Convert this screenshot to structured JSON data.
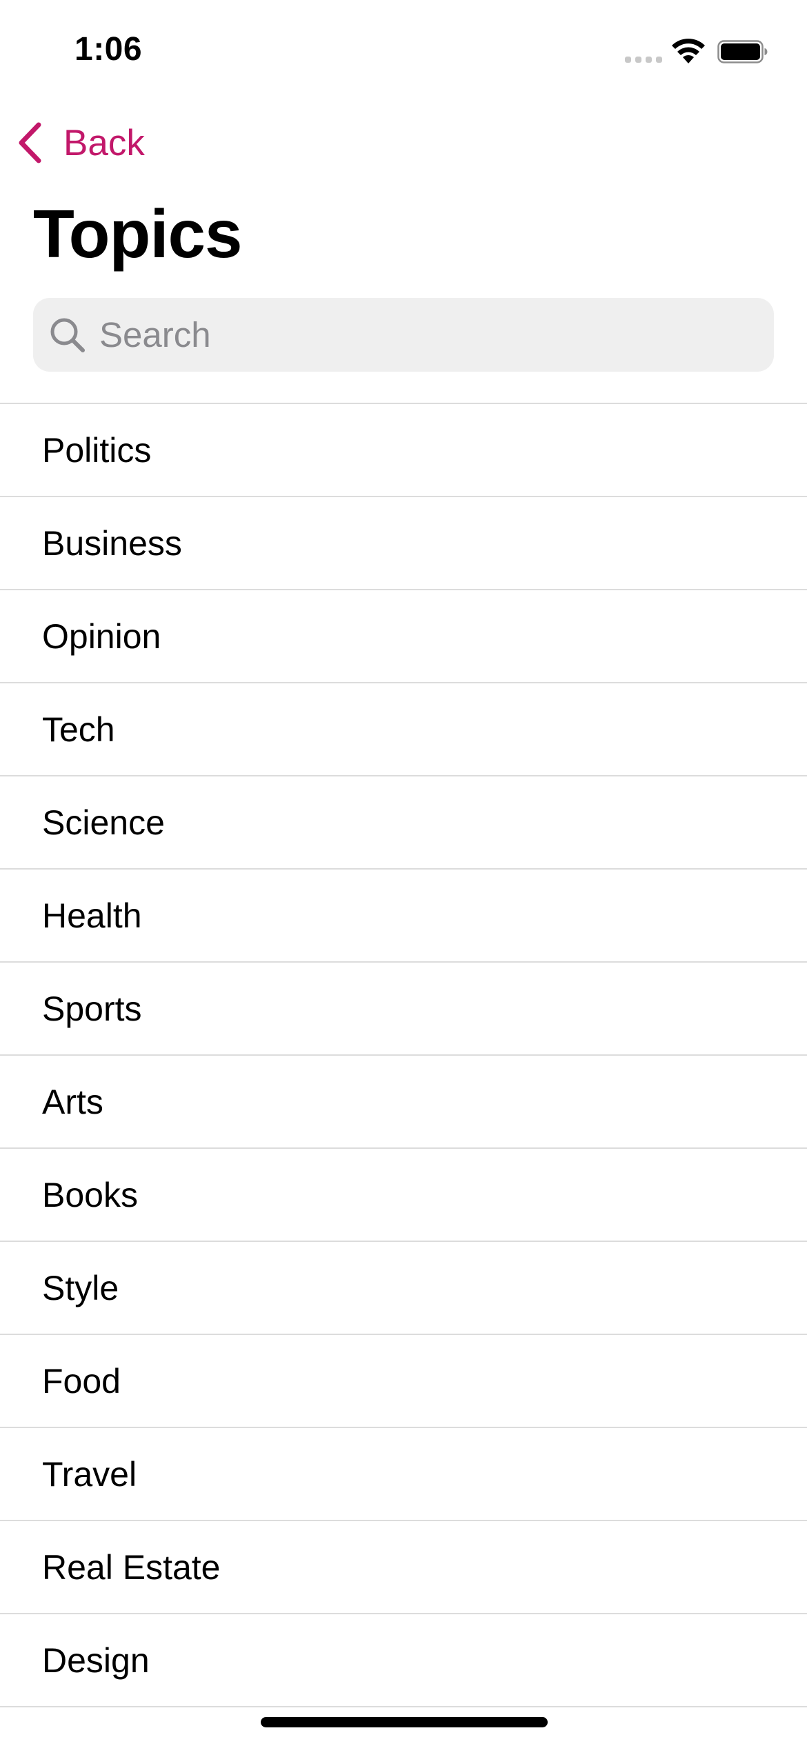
{
  "status_bar": {
    "time": "1:06",
    "icons": [
      "cellular-signal-icon",
      "wifi-icon",
      "battery-icon"
    ]
  },
  "nav": {
    "back_label": "Back",
    "back_icon": "chevron-left-icon",
    "accent_color": "#c2186a"
  },
  "page": {
    "title": "Topics"
  },
  "search": {
    "placeholder": "Search",
    "icon": "search-icon"
  },
  "topics": [
    "Politics",
    "Business",
    "Opinion",
    "Tech",
    "Science",
    "Health",
    "Sports",
    "Arts",
    "Books",
    "Style",
    "Food",
    "Travel",
    "Real Estate",
    "Design"
  ]
}
